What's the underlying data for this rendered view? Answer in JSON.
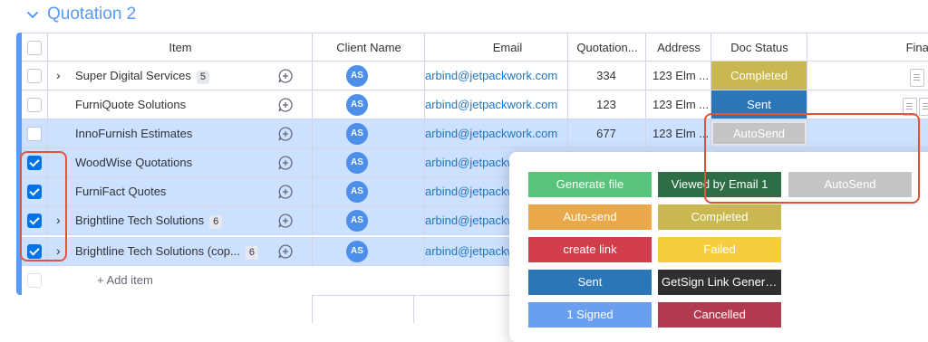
{
  "group": {
    "title": "Quotation 2",
    "accent": "#579bfc"
  },
  "columns": {
    "item": "Item",
    "client": "Client Name",
    "email": "Email",
    "quotation": "Quotation...",
    "address": "Address",
    "doc_status": "Doc Status",
    "final": "Final f"
  },
  "rows": [
    {
      "name": "Super Digital Services",
      "count": "5",
      "client": "AS",
      "email": "arbind@jetpackwork.com",
      "quotation": "334",
      "address": "123 Elm ...",
      "status": "Completed",
      "status_color": "#c9b84f",
      "selected": false,
      "expandable": true
    },
    {
      "name": "FurniQuote Solutions",
      "count": "",
      "client": "AS",
      "email": "arbind@jetpackwork.com",
      "quotation": "123",
      "address": "123 Elm ...",
      "status": "Sent",
      "status_color": "#2b76b9",
      "selected": false,
      "expandable": false
    },
    {
      "name": "InnoFurnish Estimates",
      "count": "",
      "client": "AS",
      "email": "arbind@jetpackwork.com",
      "quotation": "677",
      "address": "123 Elm ...",
      "status": "AutoSend",
      "status_color": "#c4c4c4",
      "selected": false,
      "expandable": false
    },
    {
      "name": "WoodWise Quotations",
      "count": "",
      "client": "AS",
      "email": "arbind@jetpackw",
      "selected": true,
      "expandable": false
    },
    {
      "name": "FurniFact Quotes",
      "count": "",
      "client": "AS",
      "email": "arbind@jetpackw",
      "selected": true,
      "expandable": false
    },
    {
      "name": "Brightline Tech Solutions",
      "count": "6",
      "client": "AS",
      "email": "arbind@jetpackw",
      "selected": true,
      "expandable": true
    },
    {
      "name": "Brightline Tech Solutions (cop...",
      "count": "6",
      "client": "AS",
      "email": "arbind@jetpackw",
      "selected": true,
      "expandable": true
    }
  ],
  "add_item": "+ Add item",
  "status_options": [
    {
      "label": "Generate file",
      "color": "#58c47a"
    },
    {
      "label": "Viewed by Email 1",
      "color": "#2e6e45"
    },
    {
      "label": "AutoSend",
      "color": "#c4c4c4"
    },
    {
      "label": "Auto-send",
      "color": "#e9a94b"
    },
    {
      "label": "Completed",
      "color": "#c9b84f"
    },
    {
      "label": "create link",
      "color": "#d13e4a"
    },
    {
      "label": "Failed",
      "color": "#f5cd3f"
    },
    {
      "label": "Sent",
      "color": "#2b76b9"
    },
    {
      "label": "GetSign Link Genera...",
      "color": "#2f2f2f"
    },
    {
      "label": "1 Signed",
      "color": "#6a9ff0"
    },
    {
      "label": "Cancelled",
      "color": "#b23a4f"
    }
  ]
}
